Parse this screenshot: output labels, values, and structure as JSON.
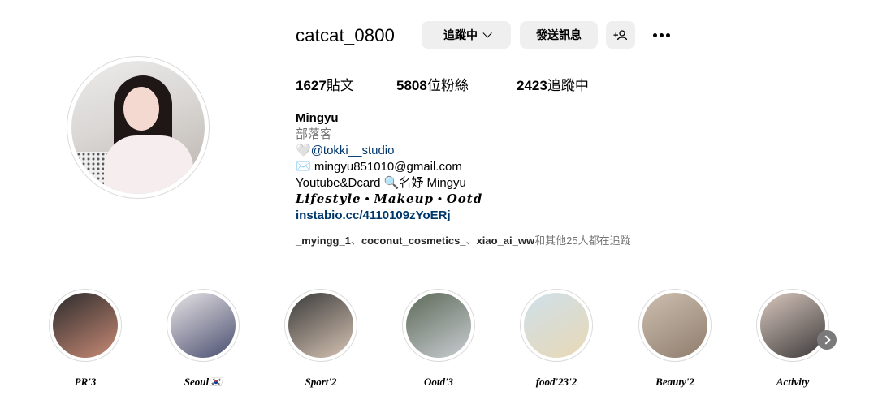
{
  "profile": {
    "username": "catcat_0800",
    "following_button": "追蹤中",
    "message_button": "發送訊息",
    "suggest_icon": "+person-icon",
    "more_icon": "ellipsis-icon"
  },
  "stats": {
    "posts_count": "1627",
    "posts_label": "貼文",
    "followers_count": "5808",
    "followers_label": "位粉絲",
    "following_count": "2423",
    "following_label": "追蹤中"
  },
  "bio": {
    "name": "Mingyu",
    "category": "部落客",
    "line1_emoji": "🤍",
    "line1_tag": "@tokki__studio",
    "line2": "✉️ mingyu851010@gmail.com",
    "line3": "Youtube&Dcard 🔍名妤 Mingyu",
    "line4": "𝑳𝒊𝒇𝒆𝒔𝒕𝒚𝒍𝒆 • 𝑴𝒂𝒌𝒆𝒖𝒑 • 𝑶𝒐𝒕𝒅",
    "link": "instabio.cc/4110109zYoERj"
  },
  "followed_by": {
    "user1": "_myingg_1",
    "sep1": "、",
    "user2": "coconut_cosmetics_",
    "sep2": "、",
    "user3": "xiao_ai_ww",
    "suffix": "和其他25人都在追蹤"
  },
  "highlights": [
    {
      "label": "PR'3",
      "color_a": "#2b2b2b",
      "color_b": "#c98a76"
    },
    {
      "label": "Seoul🇰🇷",
      "color_a": "#e8e4e6",
      "color_b": "#4a4f70"
    },
    {
      "label": "Sport'2",
      "color_a": "#3a3a3a",
      "color_b": "#d7c4b4"
    },
    {
      "label": "Ootd'3",
      "color_a": "#5d6a58",
      "color_b": "#c9cdd2"
    },
    {
      "label": "food'23'2",
      "color_a": "#cfe0ea",
      "color_b": "#e8d8b5"
    },
    {
      "label": "Beauty'2",
      "color_a": "#cdbfb0",
      "color_b": "#8f7d6d"
    },
    {
      "label": "Activity",
      "color_a": "#d9c7be",
      "color_b": "#3c3a3a"
    }
  ]
}
